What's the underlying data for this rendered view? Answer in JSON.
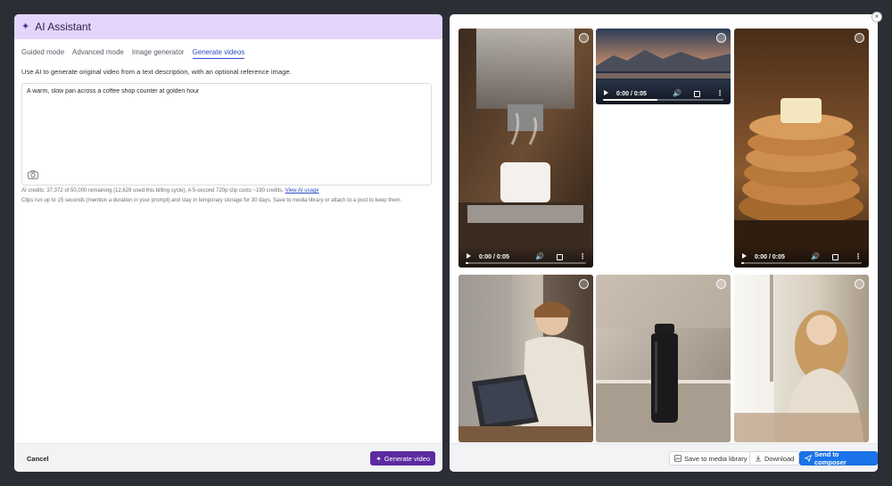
{
  "left_panel": {
    "title": "AI Assistant",
    "tabs": [
      {
        "label": "Guided mode"
      },
      {
        "label": "Advanced mode"
      },
      {
        "label": "Image generator"
      },
      {
        "label": "Generate videos",
        "active": true
      }
    ],
    "intro": "Use AI to generate original video from a text description, with an optional reference image.",
    "prompt_value": "A warm, slow pan across a coffee shop counter at golden hour",
    "credits_text": "AI credits: 37,372 of 50,000 remaining (12,628 used this billing cycle). A 5-second 720p clip costs ~190 credits.",
    "credits_link": "View AI usage",
    "clips_note": "Clips run up to 15 seconds (mention a duration in your prompt) and stay in temporary storage for 30 days. Save to media library or attach to a post to keep them.",
    "cancel_label": "Cancel",
    "generate_label": "Generate video"
  },
  "right_panel": {
    "tiles": [
      {
        "scene": "espresso-machine",
        "time": "0:00 / 0:05",
        "progress": 0.02
      },
      {
        "scene": "mountain-lake",
        "time": "0:00 / 0:05",
        "progress": 0.45
      },
      {
        "scene": "pancakes",
        "time": "0:00 / 0:05",
        "progress": 0.02
      },
      {
        "scene": "man-laptop-cafe"
      },
      {
        "scene": "black-bottle-kitchen"
      },
      {
        "scene": "woman-window"
      }
    ],
    "save_label": "Save to media library",
    "download_label": "Download",
    "send_label": "Send to composer"
  },
  "colors": {
    "header_bg": "#e3d5fb",
    "generate_btn": "#5b2aa0",
    "primary_btn": "#1a73e8",
    "link": "#2c4cc4"
  }
}
